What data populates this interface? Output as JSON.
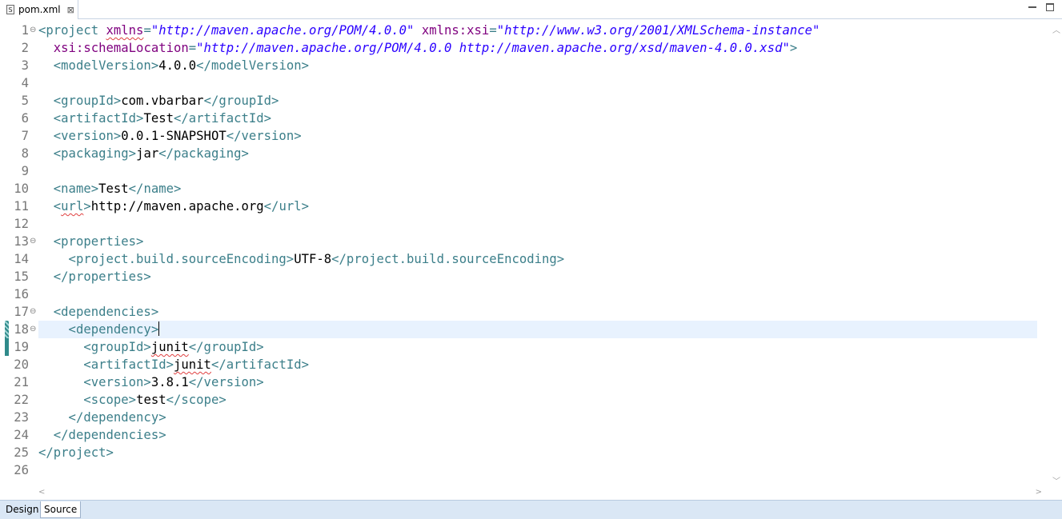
{
  "tab": {
    "icon": "S",
    "filename": "pom.xml",
    "close": "⊠"
  },
  "bottom_tabs": {
    "design": "Design",
    "source": "Source"
  },
  "colors": {
    "tag": "#3c7f8a",
    "attribute": "#7f007f",
    "value": "#2a00ff",
    "line_number": "#787878",
    "current_line": "#e8f2fe"
  },
  "icons": [
    "xml-file-icon",
    "close-tab-icon",
    "minimize-icon",
    "maximize-icon",
    "fold-icon"
  ],
  "lines": [
    {
      "n": "1",
      "fold": true,
      "parts": [
        {
          "c": "t",
          "s": "<project "
        },
        {
          "c": "a sq",
          "s": "xmlns"
        },
        {
          "c": "t",
          "s": "="
        },
        {
          "c": "v",
          "s": "\"http://maven.apache.org/POM/4.0.0\""
        },
        {
          "c": "t",
          "s": " "
        },
        {
          "c": "a",
          "s": "xmlns:xsi"
        },
        {
          "c": "t",
          "s": "="
        },
        {
          "c": "v",
          "s": "\"http://www.w3.org/2001/XMLSchema-instance\""
        }
      ]
    },
    {
      "n": "2",
      "parts": [
        {
          "c": "t",
          "s": "  "
        },
        {
          "c": "a",
          "s": "xsi:schemaLocation"
        },
        {
          "c": "t",
          "s": "="
        },
        {
          "c": "v",
          "s": "\"http://maven.apache.org/POM/4.0.0 http://maven.apache.org/xsd/maven-4.0.0.xsd\""
        },
        {
          "c": "t",
          "s": ">"
        }
      ]
    },
    {
      "n": "3",
      "parts": [
        {
          "c": "t",
          "s": "  <modelVersion>"
        },
        {
          "c": "txt",
          "s": "4.0.0"
        },
        {
          "c": "t",
          "s": "</modelVersion>"
        }
      ]
    },
    {
      "n": "4",
      "parts": []
    },
    {
      "n": "5",
      "parts": [
        {
          "c": "t",
          "s": "  <groupId>"
        },
        {
          "c": "txt",
          "s": "com.vbarbar"
        },
        {
          "c": "t",
          "s": "</groupId>"
        }
      ]
    },
    {
      "n": "6",
      "parts": [
        {
          "c": "t",
          "s": "  <artifactId>"
        },
        {
          "c": "txt",
          "s": "Test"
        },
        {
          "c": "t",
          "s": "</artifactId>"
        }
      ]
    },
    {
      "n": "7",
      "parts": [
        {
          "c": "t",
          "s": "  <version>"
        },
        {
          "c": "txt",
          "s": "0.0.1-SNAPSHOT"
        },
        {
          "c": "t",
          "s": "</version>"
        }
      ]
    },
    {
      "n": "8",
      "parts": [
        {
          "c": "t",
          "s": "  <packaging>"
        },
        {
          "c": "txt",
          "s": "jar"
        },
        {
          "c": "t",
          "s": "</packaging>"
        }
      ]
    },
    {
      "n": "9",
      "parts": []
    },
    {
      "n": "10",
      "parts": [
        {
          "c": "t",
          "s": "  <name>"
        },
        {
          "c": "txt",
          "s": "Test"
        },
        {
          "c": "t",
          "s": "</name>"
        }
      ]
    },
    {
      "n": "11",
      "parts": [
        {
          "c": "t",
          "s": "  <"
        },
        {
          "c": "t sq",
          "s": "url"
        },
        {
          "c": "t",
          "s": ">"
        },
        {
          "c": "txt",
          "s": "http://maven.apache.org"
        },
        {
          "c": "t",
          "s": "</url>"
        }
      ]
    },
    {
      "n": "12",
      "parts": []
    },
    {
      "n": "13",
      "fold": true,
      "parts": [
        {
          "c": "t",
          "s": "  <properties>"
        }
      ]
    },
    {
      "n": "14",
      "parts": [
        {
          "c": "t",
          "s": "    <project.build.sourceEncoding>"
        },
        {
          "c": "txt",
          "s": "UTF-8"
        },
        {
          "c": "t",
          "s": "</project.build.sourceEncoding>"
        }
      ]
    },
    {
      "n": "15",
      "parts": [
        {
          "c": "t",
          "s": "  </properties>"
        }
      ]
    },
    {
      "n": "16",
      "parts": []
    },
    {
      "n": "17",
      "fold": true,
      "parts": [
        {
          "c": "t",
          "s": "  <dependencies>"
        }
      ]
    },
    {
      "n": "18",
      "fold": true,
      "current": true,
      "quickdiff": "changed",
      "parts": [
        {
          "c": "t",
          "s": "    <dependency>"
        }
      ],
      "caret": true
    },
    {
      "n": "19",
      "quickdiff": "added",
      "parts": [
        {
          "c": "t",
          "s": "      <groupId>"
        },
        {
          "c": "txt sq",
          "s": "junit"
        },
        {
          "c": "t",
          "s": "</groupId>"
        }
      ]
    },
    {
      "n": "20",
      "parts": [
        {
          "c": "t",
          "s": "      <artifactId>"
        },
        {
          "c": "txt sq",
          "s": "junit"
        },
        {
          "c": "t",
          "s": "</artifactId>"
        }
      ]
    },
    {
      "n": "21",
      "parts": [
        {
          "c": "t",
          "s": "      <version>"
        },
        {
          "c": "txt",
          "s": "3.8.1"
        },
        {
          "c": "t",
          "s": "</version>"
        }
      ]
    },
    {
      "n": "22",
      "parts": [
        {
          "c": "t",
          "s": "      <scope>"
        },
        {
          "c": "txt",
          "s": "test"
        },
        {
          "c": "t",
          "s": "</scope>"
        }
      ]
    },
    {
      "n": "23",
      "parts": [
        {
          "c": "t",
          "s": "    </dependency>"
        }
      ]
    },
    {
      "n": "24",
      "parts": [
        {
          "c": "t",
          "s": "  </dependencies>"
        }
      ]
    },
    {
      "n": "25",
      "parts": [
        {
          "c": "t",
          "s": "</project>"
        }
      ]
    },
    {
      "n": "26",
      "parts": []
    }
  ]
}
